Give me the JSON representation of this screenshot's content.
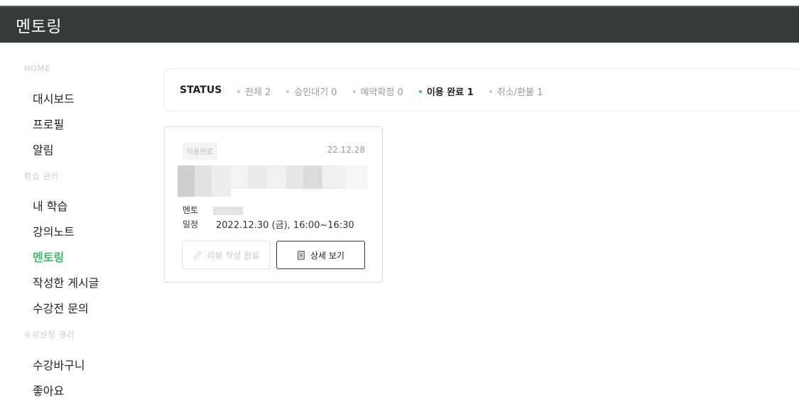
{
  "header": {
    "title": "멘토링"
  },
  "sidebar": {
    "sections": [
      {
        "label": "HOME",
        "items": [
          "대시보드",
          "프로필",
          "알림"
        ]
      },
      {
        "label": "학습 관리",
        "items": [
          "내 학습",
          "강의노트",
          "멘토링",
          "작성한 게시글",
          "수강전 문의"
        ]
      },
      {
        "label": "수강신청 관리",
        "items": [
          "수강바구니",
          "좋아요"
        ]
      }
    ],
    "active_item": "멘토링"
  },
  "status": {
    "label": "STATUS",
    "filters": [
      {
        "label": "전체 2",
        "active": false
      },
      {
        "label": "승인대기 0",
        "active": false
      },
      {
        "label": "예약확정 0",
        "active": false
      },
      {
        "label": "이용 완료 1",
        "active": true
      },
      {
        "label": "취소/환불 1",
        "active": false
      }
    ]
  },
  "card": {
    "badge": "이용완료",
    "date": "22.12.28",
    "mentor_label": "멘토",
    "schedule_label": "일정",
    "schedule_value": "2022.12.30 (금), 16:00~16:30",
    "review_button": "리뷰 작성 완료",
    "detail_button": "상세 보기"
  },
  "icons": {
    "review": "pencil-icon",
    "detail": "document-icon"
  },
  "colors": {
    "accent": "#3dbd6a",
    "header_bg": "#343a3a"
  }
}
